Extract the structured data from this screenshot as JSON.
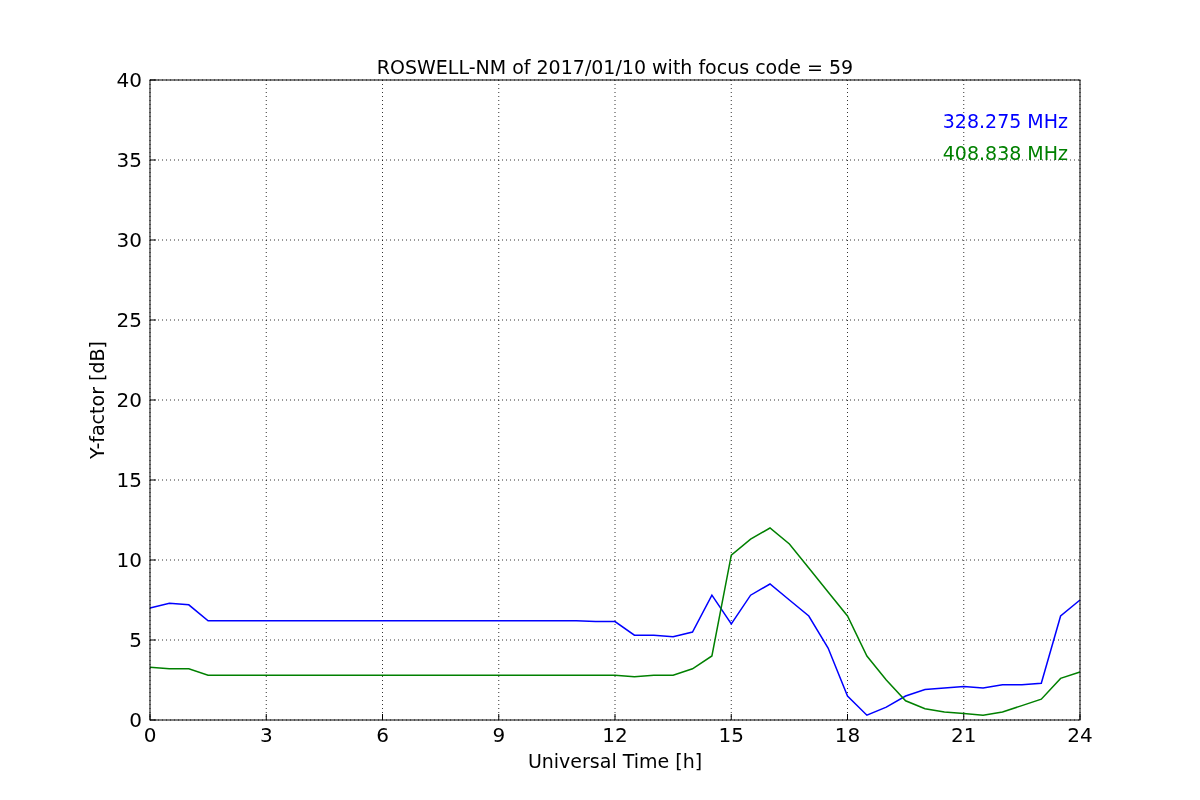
{
  "chart_data": {
    "type": "line",
    "title": "ROSWELL-NM of 2017/01/10 with focus code = 59",
    "xlabel": "Universal Time [h]",
    "ylabel": "Y-factor [dB]",
    "x": [
      0,
      0.5,
      1,
      1.5,
      2,
      2.5,
      3,
      3.5,
      4,
      4.5,
      5,
      5.5,
      6,
      6.5,
      7,
      7.5,
      8,
      8.5,
      9,
      9.5,
      10,
      10.5,
      11,
      11.5,
      12,
      12.5,
      13,
      13.5,
      14,
      14.5,
      15,
      15.5,
      16,
      16.5,
      17,
      17.5,
      18,
      18.5,
      19,
      19.5,
      20,
      20.5,
      21,
      21.5,
      22,
      22.5,
      23,
      23.5,
      24
    ],
    "series": [
      {
        "name": "328.275 MHz",
        "color": "#0000ff",
        "values": [
          7.0,
          7.3,
          7.2,
          6.2,
          6.2,
          6.2,
          6.2,
          6.2,
          6.2,
          6.2,
          6.2,
          6.2,
          6.2,
          6.2,
          6.2,
          6.2,
          6.2,
          6.2,
          6.2,
          6.2,
          6.2,
          6.2,
          6.2,
          6.15,
          6.15,
          5.3,
          5.3,
          5.2,
          5.5,
          7.8,
          6.0,
          7.8,
          8.5,
          7.5,
          6.5,
          4.5,
          1.5,
          0.3,
          0.8,
          1.5,
          1.9,
          2.0,
          2.1,
          2.0,
          2.2,
          2.2,
          2.3,
          6.5,
          7.5
        ]
      },
      {
        "name": "408.838 MHz",
        "color": "#008000",
        "values": [
          3.3,
          3.2,
          3.2,
          2.8,
          2.8,
          2.8,
          2.8,
          2.8,
          2.8,
          2.8,
          2.8,
          2.8,
          2.8,
          2.8,
          2.8,
          2.8,
          2.8,
          2.8,
          2.8,
          2.8,
          2.8,
          2.8,
          2.8,
          2.8,
          2.8,
          2.7,
          2.8,
          2.8,
          3.2,
          4.0,
          10.3,
          11.3,
          12.0,
          11.0,
          9.5,
          8.0,
          6.5,
          4.0,
          2.5,
          1.2,
          0.7,
          0.5,
          0.4,
          0.3,
          0.5,
          0.9,
          1.3,
          2.6,
          3.0
        ]
      }
    ],
    "xlim": [
      0,
      24
    ],
    "ylim": [
      0,
      40
    ],
    "xticks": [
      0,
      3,
      6,
      9,
      12,
      15,
      18,
      21,
      24
    ],
    "yticks": [
      0,
      5,
      10,
      15,
      20,
      25,
      30,
      35,
      40
    ],
    "grid": true
  }
}
